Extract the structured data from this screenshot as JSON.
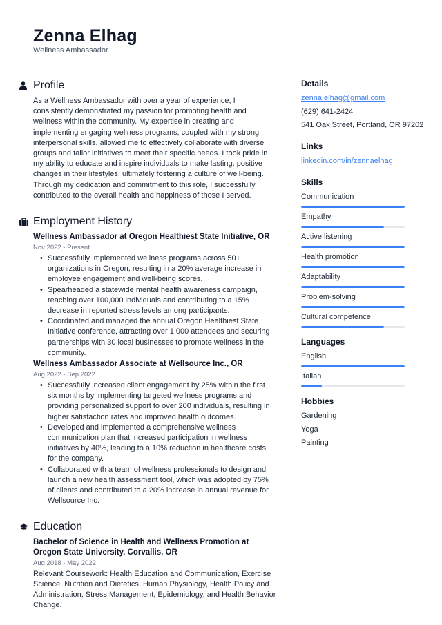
{
  "header": {
    "name": "Zenna Elhag",
    "title": "Wellness Ambassador"
  },
  "profile": {
    "heading": "Profile",
    "icon": "person-icon",
    "text": "As a Wellness Ambassador with over a year of experience, I consistently demonstrated my passion for promoting health and wellness within the community. My expertise in creating and implementing engaging wellness programs, coupled with my strong interpersonal skills, allowed me to effectively collaborate with diverse groups and tailor initiatives to meet their specific needs. I took pride in my ability to educate and inspire individuals to make lasting, positive changes in their lifestyles, ultimately fostering a culture of well-being. Through my dedication and commitment to this role, I successfully contributed to the overall health and happiness of those I served."
  },
  "employment": {
    "heading": "Employment History",
    "icon": "briefcase-icon",
    "jobs": [
      {
        "title": "Wellness Ambassador at Oregon Healthiest State Initiative, OR",
        "dates": "Nov 2022 - Present",
        "bullets": [
          "Successfully implemented wellness programs across 50+ organizations in Oregon, resulting in a 20% average increase in employee engagement and well-being scores.",
          "Spearheaded a statewide mental health awareness campaign, reaching over 100,000 individuals and contributing to a 15% decrease in reported stress levels among participants.",
          "Coordinated and managed the annual Oregon Healthiest State Initiative conference, attracting over 1,000 attendees and securing partnerships with 30 local businesses to promote wellness in the community."
        ]
      },
      {
        "title": "Wellness Ambassador Associate at Wellsource Inc., OR",
        "dates": "Aug 2022 - Sep 2022",
        "bullets": [
          "Successfully increased client engagement by 25% within the first six months by implementing targeted wellness programs and providing personalized support to over 200 individuals, resulting in higher satisfaction rates and improved health outcomes.",
          "Developed and implemented a comprehensive wellness communication plan that increased participation in wellness initiatives by 40%, leading to a 10% reduction in healthcare costs for the company.",
          "Collaborated with a team of wellness professionals to design and launch a new health assessment tool, which was adopted by 75% of clients and contributed to a 20% increase in annual revenue for Wellsource Inc."
        ]
      }
    ]
  },
  "education": {
    "heading": "Education",
    "icon": "graduation-cap-icon",
    "entries": [
      {
        "title": "Bachelor of Science in Health and Wellness Promotion at Oregon State University, Corvallis, OR",
        "dates": "Aug 2018 - May 2022",
        "text": "Relevant Coursework: Health Education and Communication, Exercise Science, Nutrition and Dietetics, Human Physiology, Health Policy and Administration, Stress Management, Epidemiology, and Health Behavior Change."
      }
    ]
  },
  "details": {
    "heading": "Details",
    "email": "zenna.elhag@gmail.com",
    "phone": "(629) 641-2424",
    "address": "541 Oak Street, Portland, OR 97202"
  },
  "links": {
    "heading": "Links",
    "items": [
      "linkedin.com/in/zennaelhag"
    ]
  },
  "skills": {
    "heading": "Skills",
    "items": [
      {
        "label": "Communication",
        "level": 1.0
      },
      {
        "label": "Empathy",
        "level": 0.8
      },
      {
        "label": "Active listening",
        "level": 1.0
      },
      {
        "label": "Health promotion",
        "level": 1.0
      },
      {
        "label": "Adaptability",
        "level": 1.0
      },
      {
        "label": "Problem-solving",
        "level": 1.0
      },
      {
        "label": "Cultural competence",
        "level": 0.8
      }
    ]
  },
  "languages": {
    "heading": "Languages",
    "items": [
      {
        "label": "English",
        "level": 1.0
      },
      {
        "label": "Italian",
        "level": 0.2
      }
    ]
  },
  "hobbies": {
    "heading": "Hobbies",
    "items": [
      "Gardening",
      "Yoga",
      "Painting"
    ]
  },
  "colors": {
    "accent": "#3b82f6",
    "track": "#e5e7eb",
    "text": "#1f2937",
    "muted": "#6b7280"
  }
}
